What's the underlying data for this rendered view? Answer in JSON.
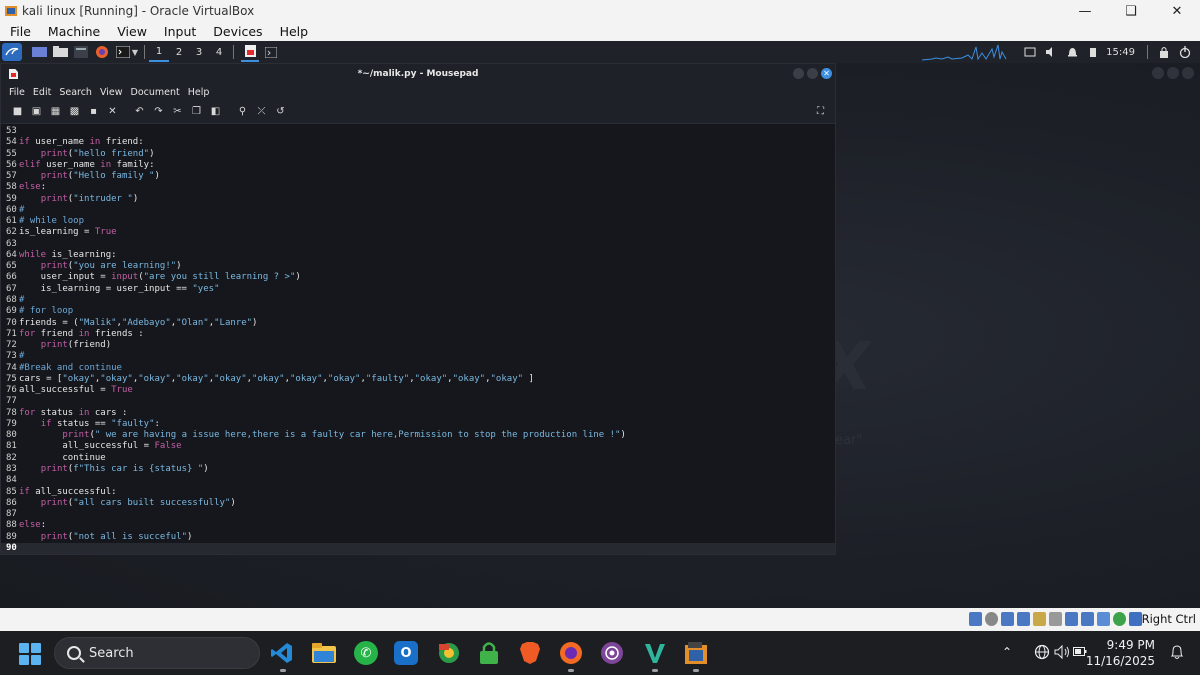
{
  "host_window": {
    "title": "kali linux [Running] - Oracle VirtualBox",
    "menu": [
      "File",
      "Machine",
      "View",
      "Input",
      "Devices",
      "Help"
    ],
    "controls": [
      "minimize",
      "restore",
      "close"
    ]
  },
  "kali_panel": {
    "workspaces": [
      "1",
      "2",
      "3",
      "4"
    ],
    "active_workspace": "1",
    "clock": "15:49"
  },
  "editor": {
    "title": "*~/malik.py - Mousepad",
    "menu": [
      "File",
      "Edit",
      "Search",
      "View",
      "Document",
      "Help"
    ],
    "current_line": "90",
    "lines": [
      {
        "n": "53",
        "t": ""
      },
      {
        "n": "54",
        "t": "if user_name in friend:"
      },
      {
        "n": "55",
        "t": "    print(\"hello friend\")"
      },
      {
        "n": "56",
        "t": "elif user_name in family:"
      },
      {
        "n": "57",
        "t": "    print(\"Hello family \")"
      },
      {
        "n": "58",
        "t": "else:"
      },
      {
        "n": "59",
        "t": "    print(\"intruder \")"
      },
      {
        "n": "60",
        "t": "#"
      },
      {
        "n": "61",
        "t": "# while loop"
      },
      {
        "n": "62",
        "t": "is_learning = True"
      },
      {
        "n": "63",
        "t": ""
      },
      {
        "n": "64",
        "t": "while is_learning:"
      },
      {
        "n": "65",
        "t": "    print(\"you are learning!\")"
      },
      {
        "n": "66",
        "t": "    user_input = input(\"are you still learning ? >\")"
      },
      {
        "n": "67",
        "t": "    is_learning = user_input == \"yes\""
      },
      {
        "n": "68",
        "t": "#"
      },
      {
        "n": "69",
        "t": "# for loop"
      },
      {
        "n": "70",
        "t": "friends = (\"Malik\",\"Adebayo\",\"Olan\",\"Lanre\")"
      },
      {
        "n": "71",
        "t": "for friend in friends :"
      },
      {
        "n": "72",
        "t": "    print(friend)"
      },
      {
        "n": "73",
        "t": "#"
      },
      {
        "n": "74",
        "t": "#Break and continue"
      },
      {
        "n": "75",
        "t": "cars = [\"okay\",\"okay\",\"okay\",\"okay\",\"okay\",\"okay\",\"okay\",\"okay\",\"faulty\",\"okay\",\"okay\",\"okay\" ]"
      },
      {
        "n": "76",
        "t": "all_successful = True"
      },
      {
        "n": "77",
        "t": ""
      },
      {
        "n": "78",
        "t": "for status in cars :"
      },
      {
        "n": "79",
        "t": "    if status == \"faulty\":"
      },
      {
        "n": "80",
        "t": "        print(\" we are having a issue here,there is a faulty car here,Permission to stop the production line !\")"
      },
      {
        "n": "81",
        "t": "        all_successful = False"
      },
      {
        "n": "82",
        "t": "        continue"
      },
      {
        "n": "83",
        "t": "    print(f\"This car is {status} \")"
      },
      {
        "n": "84",
        "t": ""
      },
      {
        "n": "85",
        "t": "if all_successful:"
      },
      {
        "n": "86",
        "t": "    print(\"all cars built successfully\")"
      },
      {
        "n": "87",
        "t": ""
      },
      {
        "n": "88",
        "t": "else:"
      },
      {
        "n": "89",
        "t": "    print(\"not all is succeful\")"
      },
      {
        "n": "90",
        "t": ""
      }
    ]
  },
  "vb_status": {
    "host_key": "Right Ctrl"
  },
  "taskbar": {
    "search_label": "Search",
    "apps": [
      "vscode",
      "file-explorer",
      "whatsapp",
      "outlook",
      "chrome-app",
      "vpn-lock",
      "brave",
      "firefox",
      "tor-browser",
      "veeam",
      "virtualbox"
    ],
    "time": "9:49 PM",
    "date": "11/16/2025"
  },
  "colors": {
    "keyword": "#c35fa6",
    "string": "#7ab8e0",
    "comment": "#6da8d8",
    "accent": "#3d8fe0"
  }
}
